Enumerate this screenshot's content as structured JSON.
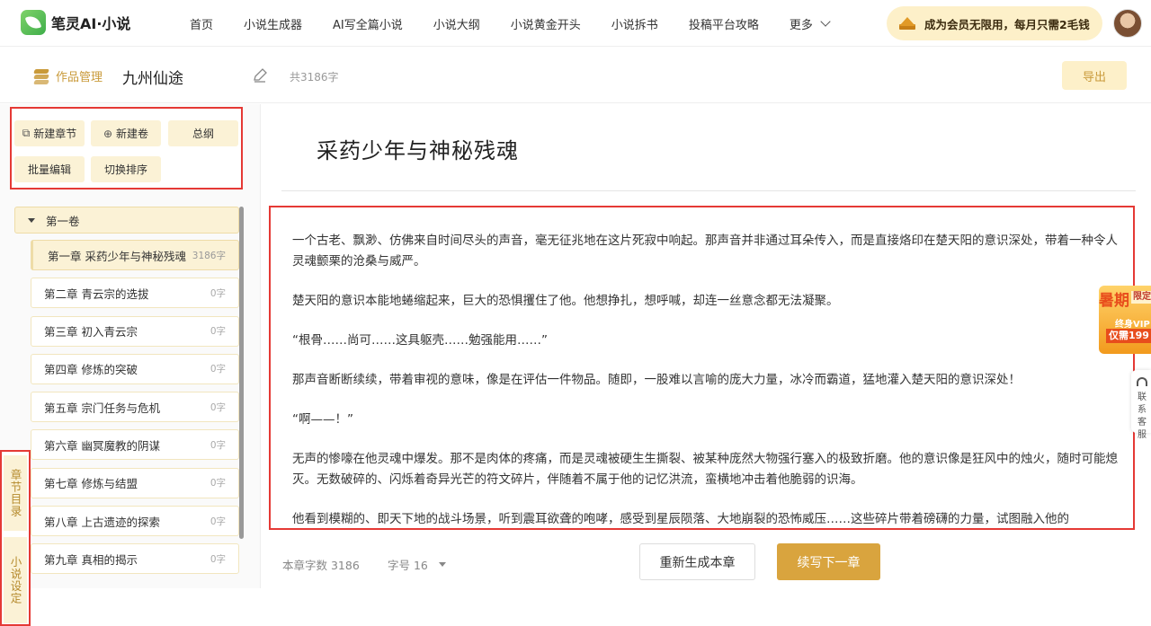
{
  "brand": {
    "name": "笔灵AI·小说"
  },
  "nav": {
    "items": [
      "首页",
      "小说生成器",
      "AI写全篇小说",
      "小说大纲",
      "小说黄金开头",
      "小说拆书",
      "投稿平台攻略"
    ],
    "more": "更多"
  },
  "vip": {
    "text": "成为会员无限用，每月只需2毛钱"
  },
  "subheader": {
    "works_label": "作品管理",
    "book_title": "九州仙途",
    "word_total": "共3186字",
    "export_label": "导出"
  },
  "toolbar": {
    "new_chapter": "新建章节",
    "new_volume": "新建卷",
    "outline": "总纲",
    "batch_edit": "批量编辑",
    "toggle_sort": "切换排序"
  },
  "volume": {
    "name": "第一卷"
  },
  "chapters": [
    {
      "title": "第一章 采药少年与神秘残魂",
      "words": "3186字"
    },
    {
      "title": "第二章 青云宗的选拔",
      "words": "0字"
    },
    {
      "title": "第三章 初入青云宗",
      "words": "0字"
    },
    {
      "title": "第四章 修炼的突破",
      "words": "0字"
    },
    {
      "title": "第五章 宗门任务与危机",
      "words": "0字"
    },
    {
      "title": "第六章 幽冥魔教的阴谋",
      "words": "0字"
    },
    {
      "title": "第七章 修炼与结盟",
      "words": "0字"
    },
    {
      "title": "第八章 上古遗迹的探索",
      "words": "0字"
    },
    {
      "title": "第九章 真相的揭示",
      "words": "0字"
    }
  ],
  "side_tabs": {
    "directory": "章节目录",
    "settings": "小说设定"
  },
  "editor": {
    "chapter_title": "采药少年与神秘残魂",
    "paragraphs": [
      "一个古老、飘渺、仿佛来自时间尽头的声音，毫无征兆地在这片死寂中响起。那声音并非通过耳朵传入，而是直接烙印在楚天阳的意识深处，带着一种令人灵魂颤栗的沧桑与威严。",
      "楚天阳的意识本能地蜷缩起来，巨大的恐惧攫住了他。他想挣扎，想呼喊，却连一丝意念都无法凝聚。",
      "“根骨……尚可……这具躯壳……勉强能用……”",
      "那声音断断续续，带着审视的意味，像是在评估一件物品。随即，一股难以言喻的庞大力量，冰冷而霸道，猛地灌入楚天阳的意识深处！",
      "“啊——！”",
      "无声的惨嚎在他灵魂中爆发。那不是肉体的疼痛，而是灵魂被硬生生撕裂、被某种庞然大物强行塞入的极致折磨。他的意识像是狂风中的烛火，随时可能熄灭。无数破碎的、闪烁着奇异光芒的符文碎片，伴随着不属于他的记忆洪流，蛮横地冲击着他脆弱的识海。",
      "他看到模糊的、即天下地的战斗场景，听到震耳欲聋的咆哮，感受到星辰陨落、大地崩裂的恐怖威压……这些碎片带着磅礴的力量，试图融入他的"
    ]
  },
  "footer": {
    "chapter_words": "本章字数 3186",
    "font_size": "字号 16",
    "regenerate": "重新生成本章",
    "continue": "续写下一章"
  },
  "promo": {
    "big": "暑期",
    "tag": "限定",
    "small": "终身VIP",
    "price": "仅需199"
  },
  "service": {
    "text": "联系客服"
  }
}
